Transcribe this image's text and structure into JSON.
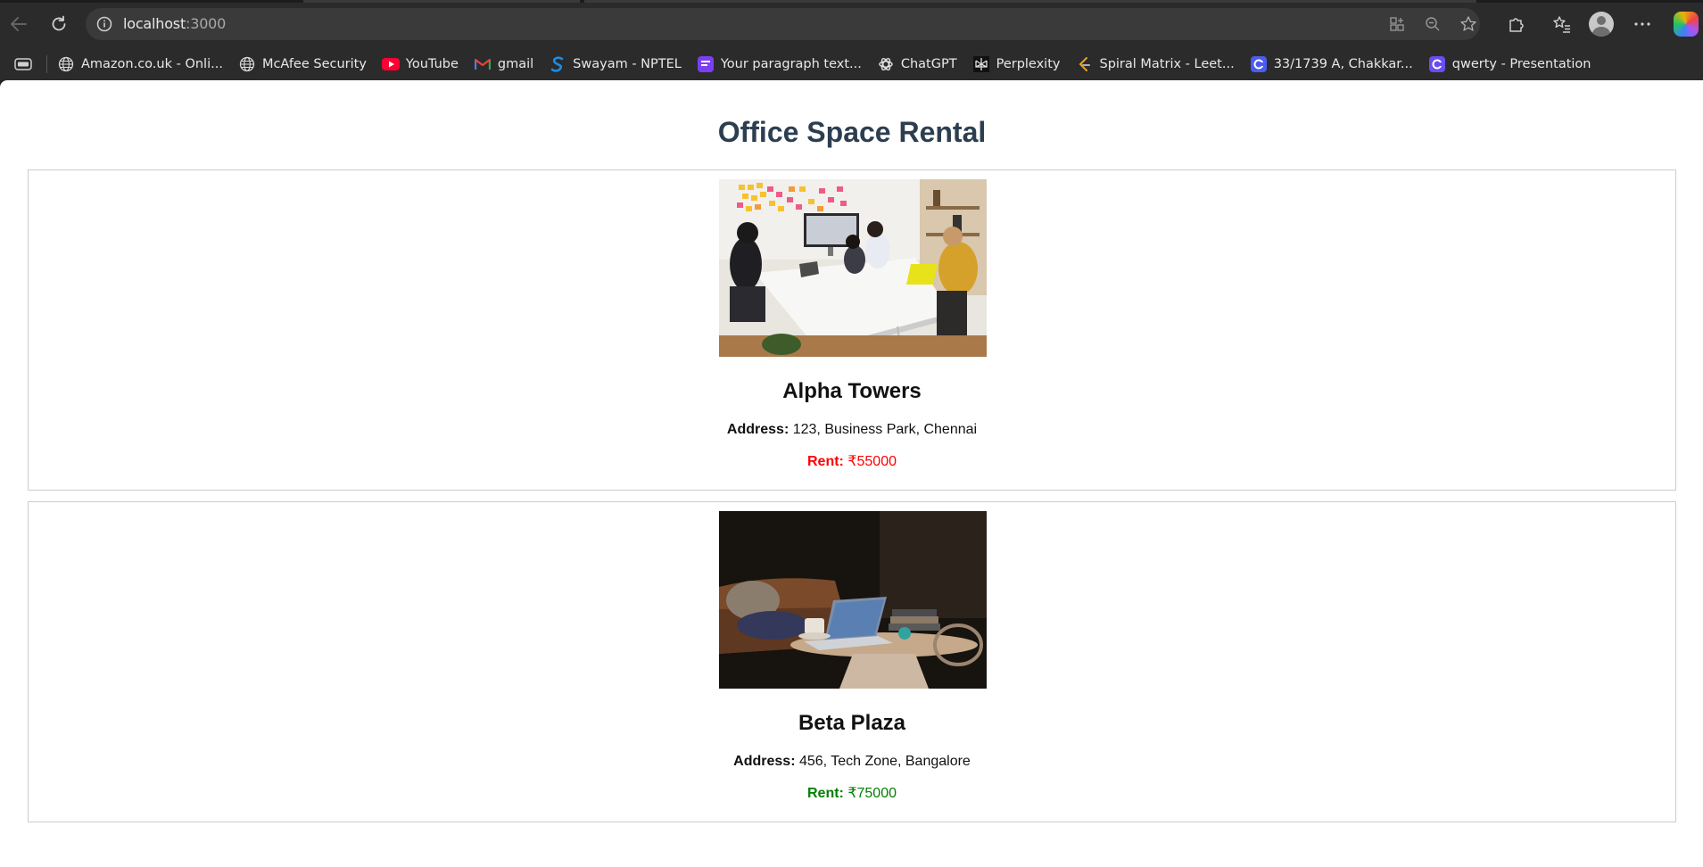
{
  "browser": {
    "url_host": "localhost",
    "url_port": ":3000",
    "bookmarks": [
      {
        "label": "Amazon.co.uk - Onli...",
        "icon": "globe-icon"
      },
      {
        "label": "McAfee Security",
        "icon": "globe-icon"
      },
      {
        "label": "YouTube",
        "icon": "youtube-icon"
      },
      {
        "label": "gmail",
        "icon": "gmail-icon"
      },
      {
        "label": "Swayam - NPTEL",
        "icon": "swayam-icon"
      },
      {
        "label": "Your paragraph text...",
        "icon": "canva-icon"
      },
      {
        "label": "ChatGPT",
        "icon": "chatgpt-icon"
      },
      {
        "label": "Perplexity",
        "icon": "perplexity-icon"
      },
      {
        "label": "Spiral Matrix - Leet...",
        "icon": "leetcode-icon"
      },
      {
        "label": "33/1739 A, Chakkar...",
        "icon": "copilot-page-icon"
      },
      {
        "label": "qwerty - Presentation",
        "icon": "copilot-page-icon"
      }
    ]
  },
  "page": {
    "title": "Office Space Rental",
    "address_label": "Address:",
    "rent_label": "Rent:",
    "offices": [
      {
        "name": "Alpha Towers",
        "address": "123, Business Park, Chennai",
        "rent": "₹55000",
        "rent_color": "#ff0000",
        "image": "office-meeting-photo"
      },
      {
        "name": "Beta Plaza",
        "address": "456, Tech Zone, Bangalore",
        "rent": "₹75000",
        "rent_color": "#008000",
        "image": "laptop-lounge-photo"
      }
    ]
  }
}
